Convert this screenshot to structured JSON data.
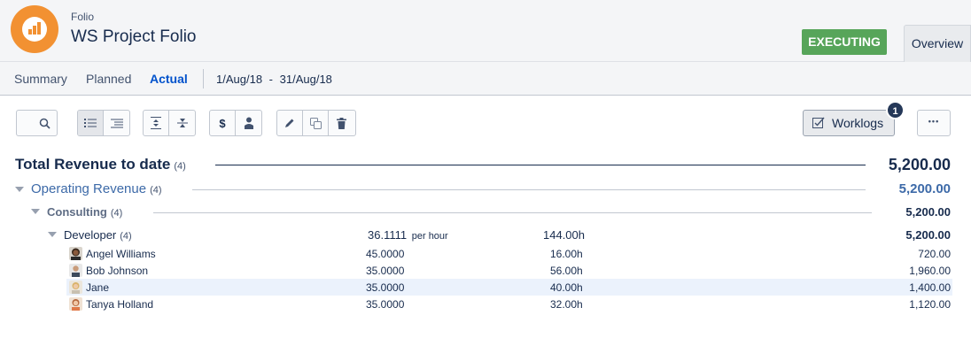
{
  "header": {
    "app_small": "Folio",
    "title": "WS Project Folio",
    "status": "EXECUTING",
    "overview_tab": "Overview"
  },
  "subnav": {
    "tabs": [
      {
        "label": "Summary"
      },
      {
        "label": "Planned"
      },
      {
        "label": "Actual"
      }
    ],
    "active_tab": "Actual",
    "date_start": "1/Aug/18",
    "date_sep": "-",
    "date_end": "31/Aug/18"
  },
  "toolbar": {
    "currency_symbol": "$",
    "worklogs_label": "Worklogs",
    "worklogs_badge": "1",
    "more_label": "•••"
  },
  "report": {
    "total": {
      "label": "Total Revenue to date",
      "count": "(4)",
      "value": "5,200.00"
    },
    "operating": {
      "label": "Operating Revenue",
      "count": "(4)",
      "value": "5,200.00"
    },
    "consulting": {
      "label": "Consulting",
      "count": "(4)",
      "value": "5,200.00"
    },
    "developer": {
      "label": "Developer",
      "count": "(4)",
      "rate": "36.1111",
      "rate_unit": "per hour",
      "hours": "144.00h",
      "value": "5,200.00"
    },
    "people": [
      {
        "name": "Angel Williams",
        "rate": "45.0000",
        "hours": "16.00h",
        "amount": "720.00"
      },
      {
        "name": "Bob Johnson",
        "rate": "35.0000",
        "hours": "56.00h",
        "amount": "1,960.00"
      },
      {
        "name": "Jane",
        "rate": "35.0000",
        "hours": "40.00h",
        "amount": "1,400.00"
      },
      {
        "name": "Tanya Holland",
        "rate": "35.0000",
        "hours": "32.00h",
        "amount": "1,120.00"
      }
    ]
  },
  "colors": {
    "accent_blue": "#0052cc",
    "operating_blue": "#3d6aa8",
    "executing_green": "#57a55a",
    "logo_orange": "#f29132"
  }
}
